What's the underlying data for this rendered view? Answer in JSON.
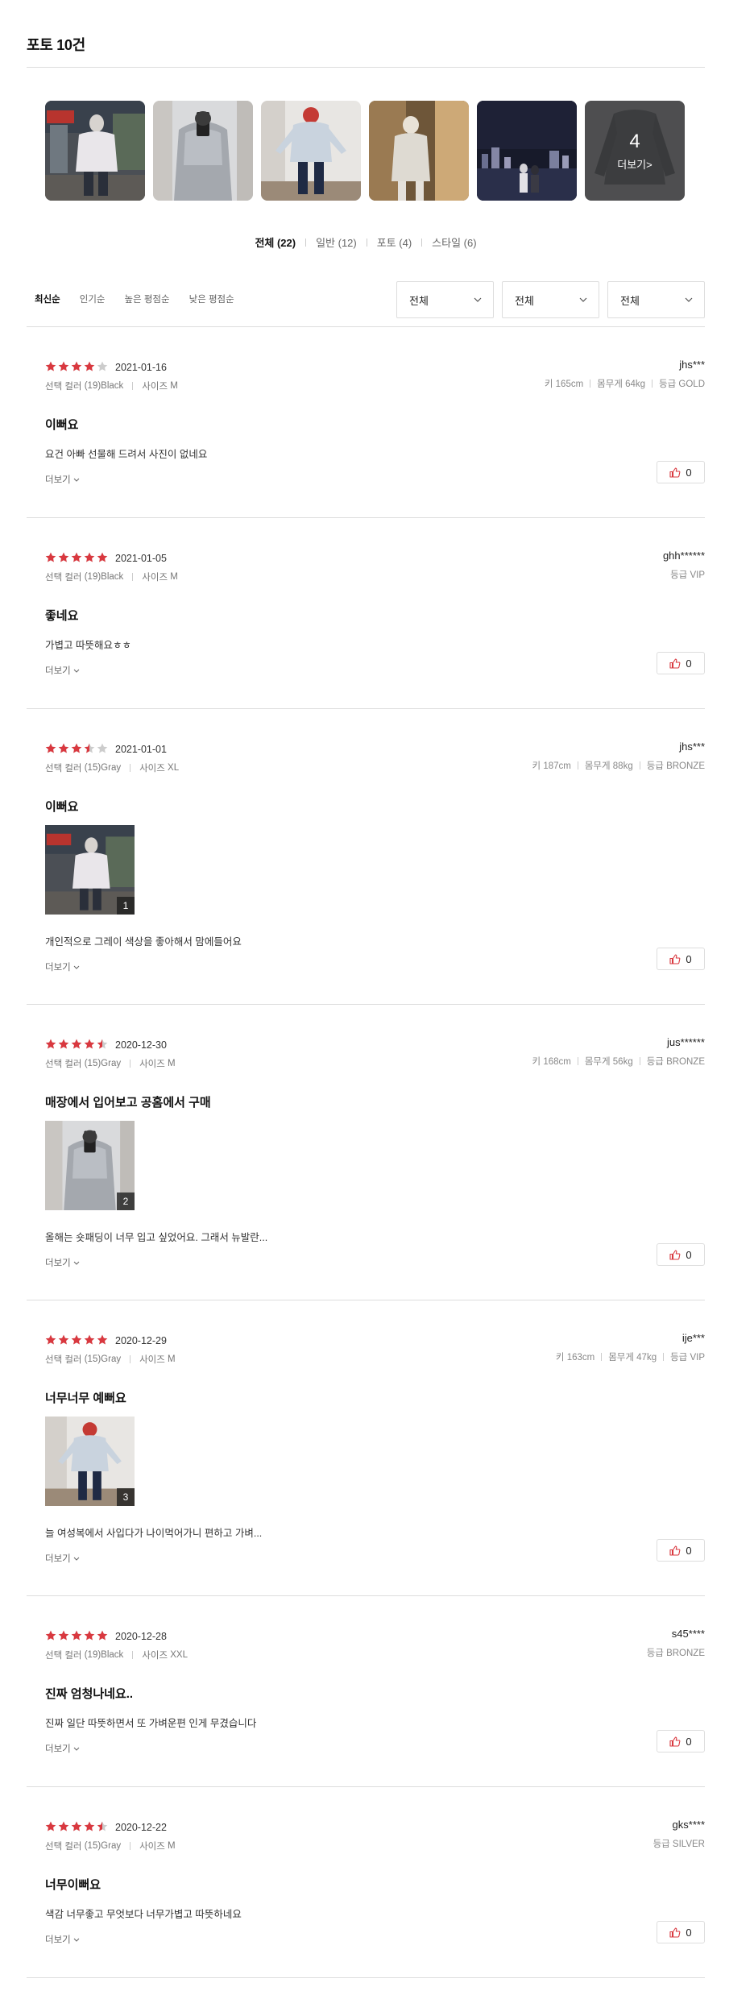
{
  "photo_section": {
    "heading": "포토 10건",
    "thumbnails": [
      {
        "icon": "photo-front-view"
      },
      {
        "icon": "photo-mirror-selfie"
      },
      {
        "icon": "photo-front-view-arms-out"
      },
      {
        "icon": "photo-mirror-selfie-doorway"
      },
      {
        "icon": "photo-night-cityscape"
      },
      {
        "icon": "photo-jacket-product",
        "more_count": "4",
        "more_label": "더보기>"
      }
    ]
  },
  "type_tabs": [
    {
      "label": "전체 (22)",
      "active": true
    },
    {
      "label": "일반 (12)",
      "active": false
    },
    {
      "label": "포토 (4)",
      "active": false
    },
    {
      "label": "스타일 (6)",
      "active": false
    }
  ],
  "sorts": [
    {
      "label": "최신순",
      "active": true
    },
    {
      "label": "인기순",
      "active": false
    },
    {
      "label": "높은 평점순",
      "active": false
    },
    {
      "label": "낮은 평점순",
      "active": false
    }
  ],
  "filters": [
    {
      "label": "전체",
      "icon": "chevron-down-icon"
    },
    {
      "label": "전체",
      "icon": "chevron-down-icon"
    },
    {
      "label": "전체",
      "icon": "chevron-down-icon"
    }
  ],
  "colors": {
    "star": "#d9383f",
    "star_empty": "#cccccc",
    "like_icon": "#d9383f",
    "divider": "#dddddd"
  },
  "reviews": [
    {
      "rating": 4,
      "date": "2021-01-16",
      "color_label": "선택 컬러",
      "color_value": "(19)Black",
      "size_label": "사이즈",
      "size_value": "M",
      "user": "jhs***",
      "height": "키 165cm",
      "weight": "몸무게 64kg",
      "grade": "등급 GOLD",
      "title": "이뻐요",
      "body": "요건 아빠 선물해 드려서 사진이 없네요",
      "more": "더보기",
      "likes": "0"
    },
    {
      "rating": 5,
      "date": "2021-01-05",
      "color_label": "선택 컬러",
      "color_value": "(19)Black",
      "size_label": "사이즈",
      "size_value": "M",
      "user": "ghh******",
      "height": "",
      "weight": "",
      "grade": "등급 VIP",
      "title": "좋네요",
      "body": "가볍고 따뜻해요ㅎㅎ",
      "more": "더보기",
      "likes": "0"
    },
    {
      "rating": 3.5,
      "date": "2021-01-01",
      "color_label": "선택 컬러",
      "color_value": "(15)Gray",
      "size_label": "사이즈",
      "size_value": "XL",
      "user": "jhs***",
      "height": "키 187cm",
      "weight": "몸무게 88kg",
      "grade": "등급 BRONZE",
      "title": "이뻐요",
      "photo": {
        "num": "1",
        "icon": "photo-front-view"
      },
      "body": "개인적으로 그레이 색상을 좋아해서 맘에들어요",
      "more": "더보기",
      "likes": "0"
    },
    {
      "rating": 4.5,
      "date": "2020-12-30",
      "color_label": "선택 컬러",
      "color_value": "(15)Gray",
      "size_label": "사이즈",
      "size_value": "M",
      "user": "jus******",
      "height": "키 168cm",
      "weight": "몸무게 56kg",
      "grade": "등급 BRONZE",
      "title": "매장에서 입어보고 공홈에서 구매",
      "photo": {
        "num": "2",
        "icon": "photo-mirror-selfie"
      },
      "body": "올해는 숏패딩이 너무 입고 싶었어요. 그래서 뉴발란...",
      "more": "더보기",
      "likes": "0"
    },
    {
      "rating": 5,
      "date": "2020-12-29",
      "color_label": "선택 컬러",
      "color_value": "(15)Gray",
      "size_label": "사이즈",
      "size_value": "M",
      "user": "ije***",
      "height": "키 163cm",
      "weight": "몸무게 47kg",
      "grade": "등급 VIP",
      "title": "너무너무 예뻐요",
      "photo": {
        "num": "3",
        "icon": "photo-front-view-arms-out"
      },
      "body": "늘 여성복에서 사입다가 나이먹어가니 편하고 가벼...",
      "more": "더보기",
      "likes": "0"
    },
    {
      "rating": 5,
      "date": "2020-12-28",
      "color_label": "선택 컬러",
      "color_value": "(19)Black",
      "size_label": "사이즈",
      "size_value": "XXL",
      "user": "s45****",
      "height": "",
      "weight": "",
      "grade": "등급 BRONZE",
      "title": "진짜 엄청나네요..",
      "body": "진짜 일단 따뜻하면서 또 가벼운편 인게 무겼습니다",
      "more": "더보기",
      "likes": "0"
    },
    {
      "rating": 4.5,
      "date": "2020-12-22",
      "color_label": "선택 컬러",
      "color_value": "(15)Gray",
      "size_label": "사이즈",
      "size_value": "M",
      "user": "gks****",
      "height": "",
      "weight": "",
      "grade": "등급 SILVER",
      "title": "너무이뻐요",
      "body": "색감 너무좋고 무엇보다 너무가볍고 따뜻하네요",
      "more": "더보기",
      "likes": "0"
    }
  ]
}
